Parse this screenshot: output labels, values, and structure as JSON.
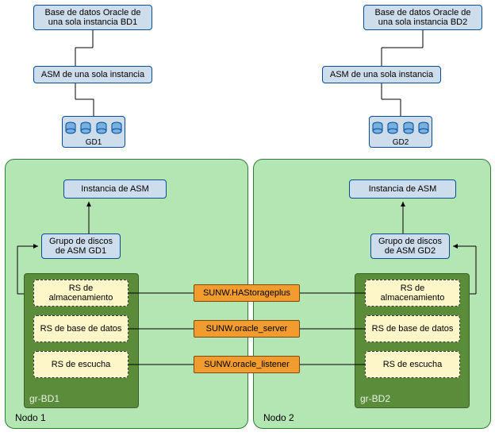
{
  "left": {
    "db_label": "Base de datos Oracle de una sola instancia BD1",
    "asm_label": "ASM de una sola instancia",
    "dg_label": "GD1",
    "node": {
      "label": "Nodo 1",
      "asm_instance": "Instancia de ASM",
      "asm_dg": "Grupo de discos de ASM GD1",
      "rs_group_label": "gr-BD1",
      "rs1": "RS de almacenamiento",
      "rs2": "RS de base de datos",
      "rs3": "RS de escucha"
    }
  },
  "right": {
    "db_label": "Base de datos Oracle de una sola instancia BD2",
    "asm_label": "ASM de una sola instancia",
    "dg_label": "GD2",
    "node": {
      "label": "Nodo 2",
      "asm_instance": "Instancia de ASM",
      "asm_dg": "Grupo de discos de ASM GD2",
      "rs_group_label": "gr-BD2",
      "rs1": "RS de almacenamiento",
      "rs2": "RS de base de datos",
      "rs3": "RS de escucha"
    }
  },
  "resource_types": {
    "storage": "SUNW.HAStorageplus",
    "server": "SUNW.oracle_server",
    "listener": "SUNW.oracle_listener"
  }
}
